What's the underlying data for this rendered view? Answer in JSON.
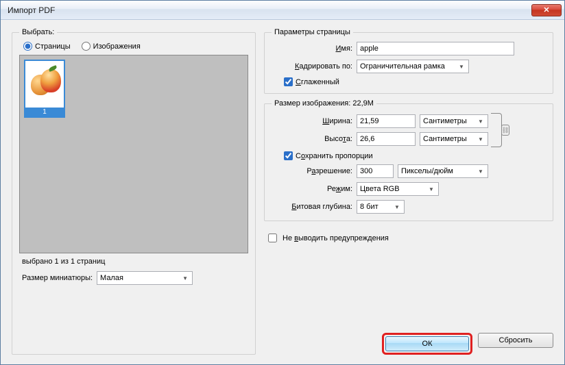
{
  "title": "Импорт PDF",
  "select": {
    "legend": "Выбрать:",
    "opt_pages": "Страницы",
    "opt_images": "Изображения",
    "thumb_index": "1",
    "selected_text": "выбрано 1 из 1 страниц",
    "thumbsize_label": "Размер миниатюры:",
    "thumbsize_value": "Малая"
  },
  "page": {
    "legend": "Параметры страницы",
    "name_label": "Имя:",
    "name_value": "apple",
    "crop_label": "Кадрировать по:",
    "crop_value": "Ограничительная рамка",
    "antialias": "Сглаженный"
  },
  "image": {
    "legend": "Размер изображения: 22,9M",
    "width_label": "Ширина:",
    "width_value": "21,59",
    "width_unit": "Сантиметры",
    "height_label": "Высота:",
    "height_value": "26,6",
    "height_unit": "Сантиметры",
    "keep_prop": "Сохранить пропорции",
    "res_label": "Разрешение:",
    "res_value": "300",
    "res_unit": "Пикселы/дюйм",
    "mode_label": "Режим:",
    "mode_value": "Цвета RGB",
    "depth_label": "Битовая глубина:",
    "depth_value": "8 бит"
  },
  "suppress_warn": "Не выводить предупреждения",
  "buttons": {
    "ok": "ОК",
    "reset": "Сбросить"
  }
}
